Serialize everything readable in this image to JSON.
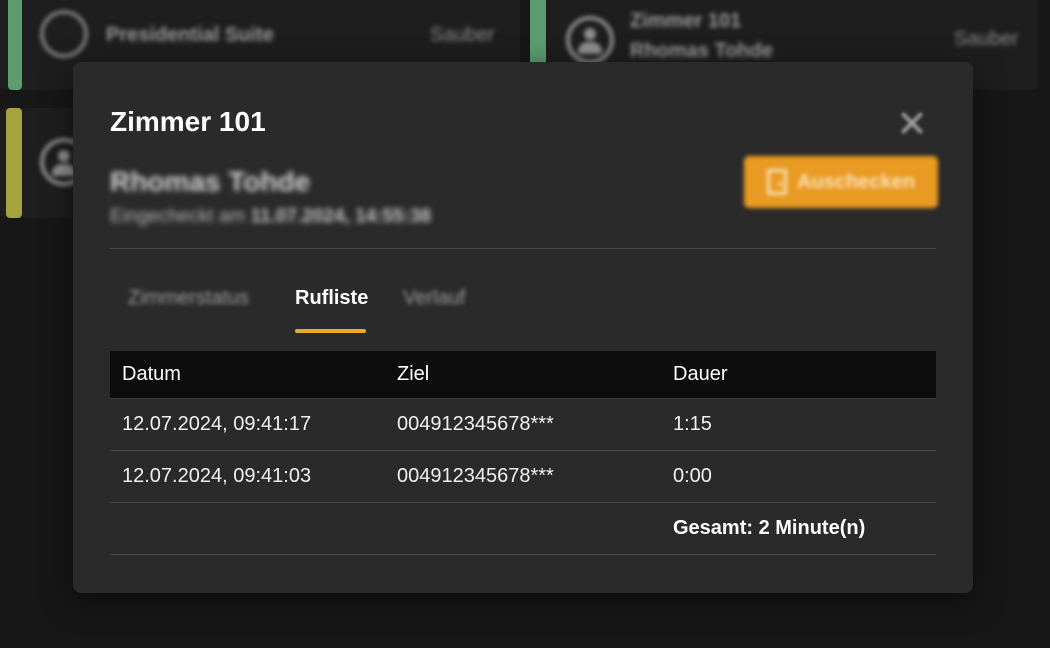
{
  "background_cards": [
    {
      "title": "Presidential Suite",
      "guest": "",
      "status": "Sauber",
      "accent": "#5b9c70"
    },
    {
      "title": "Zimmer 101",
      "guest": "Rhomas Tohde",
      "status": "Sauber",
      "accent": "#5b9c70"
    },
    {
      "title": "",
      "guest": "",
      "status": "",
      "accent": "#a6a33f"
    }
  ],
  "modal": {
    "title": "Zimmer 101",
    "guest_name": "Rhomas Tohde",
    "checkin_label": "Eingecheckt am",
    "checkin_date": "11.07.2024, 14:55:38",
    "checkout_label": "Auschecken",
    "checkout_color": "#e89a22",
    "close_icon": "close-icon"
  },
  "tabs": [
    {
      "label": "Zimmerstatus",
      "active": false
    },
    {
      "label": "Rufliste",
      "active": true
    },
    {
      "label": "Verlauf",
      "active": false
    }
  ],
  "call_table": {
    "columns": [
      "Datum",
      "Ziel",
      "Dauer"
    ],
    "rows": [
      [
        "12.07.2024, 09:41:17",
        "004912345678***",
        "1:15"
      ],
      [
        "12.07.2024, 09:41:03",
        "004912345678***",
        "0:00"
      ]
    ],
    "total": "Gesamt: 2 Minute(n)"
  },
  "accent_color": "#f0a92a"
}
